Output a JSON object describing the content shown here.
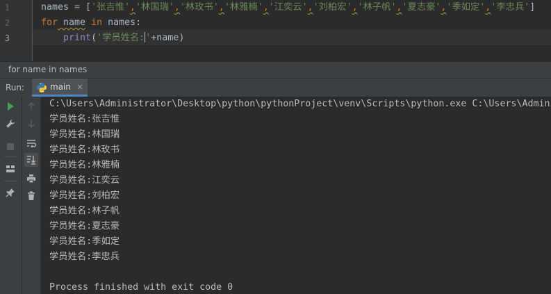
{
  "editor": {
    "line_numbers": [
      "1",
      "2",
      "3"
    ],
    "line1": {
      "p1": "names = [",
      "items": [
        "'张吉惟'",
        "'林国瑞'",
        "'林玫书'",
        "'林雅楠'",
        "'江奕云'",
        "'刘柏宏'",
        "'林子帆'",
        "'夏志豪'",
        "'季如定'",
        "'李忠兵'"
      ],
      "comma": ",",
      "p_end": "]"
    },
    "line2": {
      "kw_for": "for",
      "var": " name",
      "kw_in": " in",
      "rest": " names:"
    },
    "line3": {
      "indent": "    ",
      "fn": "print",
      "open": "(",
      "str_a": "'学员姓名:",
      "str_b": "'",
      "rest": "+name)"
    }
  },
  "breadcrumb": {
    "text": "for name in names"
  },
  "run_panel": {
    "label": "Run:",
    "tab_name": "main",
    "tab_close": "×",
    "console_lines": [
      "C:\\Users\\Administrator\\Desktop\\python\\pythonProject\\venv\\Scripts\\python.exe C:\\Users\\Administ",
      "学员姓名:张吉惟",
      "学员姓名:林国瑞",
      "学员姓名:林玫书",
      "学员姓名:林雅楠",
      "学员姓名:江奕云",
      "学员姓名:刘柏宏",
      "学员姓名:林子帆",
      "学员姓名:夏志豪",
      "学员姓名:季如定",
      "学员姓名:李忠兵",
      "",
      "Process finished with exit code 0"
    ]
  },
  "icons": {
    "toolbar_left": [
      "run-icon",
      "wrench-icon",
      "stop-icon",
      "layout-icon",
      "pin-icon"
    ],
    "toolbar_right": [
      "up-arrow-icon",
      "down-arrow-icon",
      "soft-wrap-icon",
      "scroll-to-end-icon",
      "print-icon",
      "trash-icon"
    ]
  },
  "colors": {
    "background": "#2b2b2b",
    "keyword": "#cc7832",
    "string": "#6a8759",
    "builtin": "#8888c6",
    "run_green": "#499c54",
    "tab_underline": "#4a88c7"
  }
}
